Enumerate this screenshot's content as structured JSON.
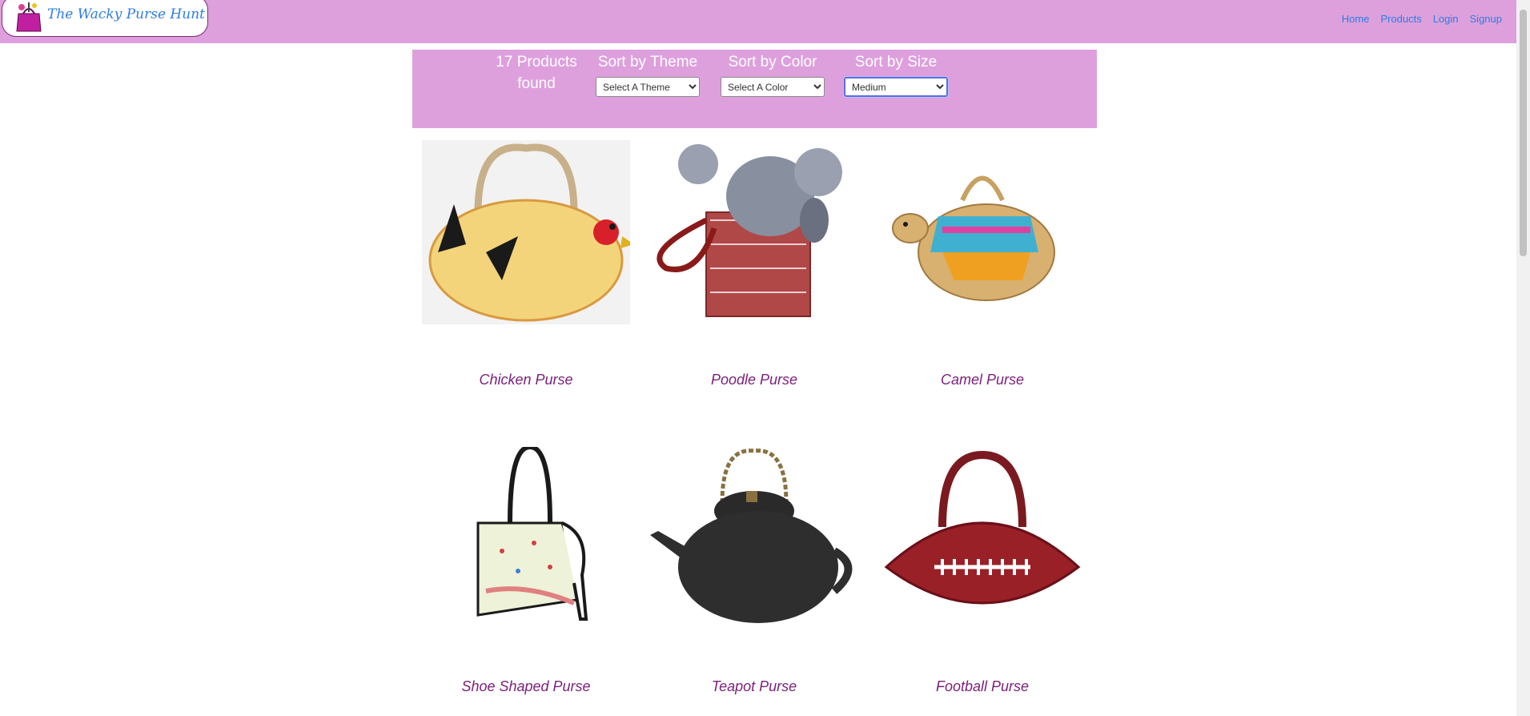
{
  "brand": {
    "title": "The Wacky Purse Hunt"
  },
  "nav": {
    "links": [
      "Home",
      "Products",
      "Login",
      "Signup"
    ]
  },
  "filters": {
    "count_text": "17 Products found",
    "theme": {
      "label": "Sort by Theme",
      "value": "Select A Theme"
    },
    "color": {
      "label": "Sort by Color",
      "value": "Select A Color"
    },
    "size": {
      "label": "Sort by Size",
      "value": "Medium"
    }
  },
  "products": [
    {
      "name": "Chicken Purse",
      "icon": "chicken-purse-image"
    },
    {
      "name": "Poodle Purse",
      "icon": "poodle-purse-image"
    },
    {
      "name": "Camel Purse",
      "icon": "camel-purse-image"
    },
    {
      "name": "Shoe Shaped Purse",
      "icon": "shoe-purse-image"
    },
    {
      "name": "Teapot Purse",
      "icon": "teapot-purse-image"
    },
    {
      "name": "Football Purse",
      "icon": "football-purse-image"
    }
  ],
  "colors": {
    "accent": "#dda0dd",
    "link": "#2f7de0",
    "product_name": "#7a1f7a"
  }
}
